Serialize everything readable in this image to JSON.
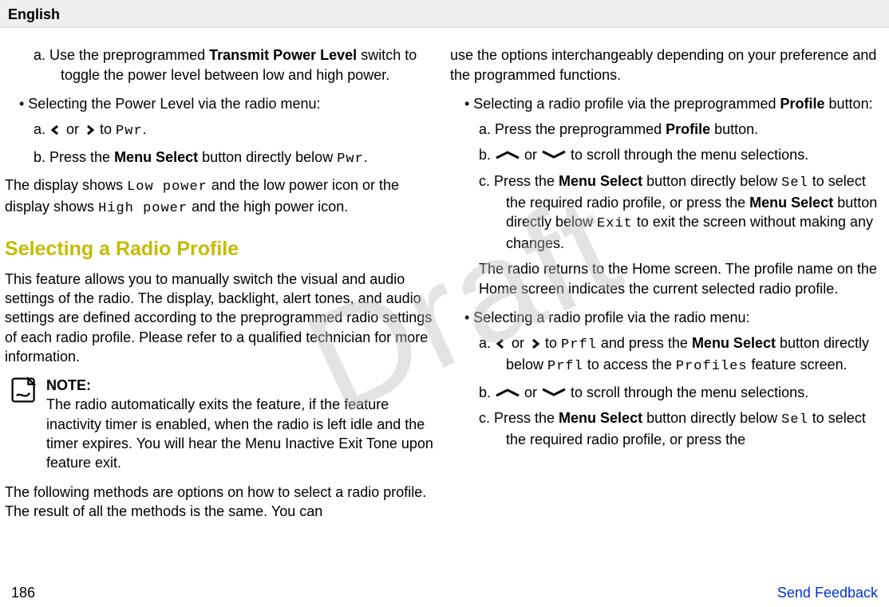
{
  "header": "English",
  "watermark": "Draft",
  "page_number": "186",
  "feedback_link": "Send Feedback",
  "section_heading": "Selecting a Radio Profile",
  "note_label": "NOTE:",
  "left": {
    "a1_pre": "a.   Use the preprogrammed ",
    "a1_bold": "Transmit Power Level",
    "a1_post": " switch to toggle the power level between low and high power.",
    "bullet1": "•   Selecting the Power Level via the radio menu:",
    "a2_pre": "a.   ",
    "a2_or": " or ",
    "a2_to": " to ",
    "a2_pwr": "Pwr",
    "a2_end": ".",
    "b1_pre": "b.   Press the ",
    "b1_bold": "Menu Select",
    "b1_post": " button directly below ",
    "b1_pwr": "Pwr",
    "b1_end": ".",
    "para1_pre": "The display shows ",
    "para1_low": "Low power",
    "para1_mid": " and the low power icon or the display shows ",
    "para1_high": "High power",
    "para1_end": " and the high power icon.",
    "intro": "This feature allows you to manually switch the visual and audio settings of the radio. The display, backlight, alert tones, and audio settings are defined according to the preprogrammed radio settings of each radio profile. Please refer to a qualified technician for more information.",
    "note_body": "The radio automatically exits the feature, if the feature inactivity timer is enabled, when the radio is left idle and the timer expires. You will hear the Menu Inactive Exit Tone upon feature exit.",
    "para2": "The following methods are options on how to select a radio profile. The result of all the methods is the same. You can"
  },
  "right": {
    "cont": "use the options interchangeably depending on your preference and the programmed functions.",
    "bullet1_pre": "•   Selecting a radio profile via the preprogrammed ",
    "bullet1_bold": "Profile",
    "bullet1_post": " button:",
    "r_a1_pre": "a.   Press the preprogrammed ",
    "r_a1_bold": "Profile",
    "r_a1_post": " button.",
    "r_b1_pre": "b.   ",
    "r_b1_or": " or ",
    "r_b1_post": " to scroll through the menu selections.",
    "r_c1_pre": "c.   Press the ",
    "r_c1_bold1": "Menu Select",
    "r_c1_mid1": " button directly below ",
    "r_c1_sel": "Sel",
    "r_c1_mid2": " to select the required radio profile, or press the ",
    "r_c1_bold2": "Menu Select",
    "r_c1_mid3": " button directly below ",
    "r_c1_exit": "Exit",
    "r_c1_end": " to exit the screen without making any changes.",
    "para3": "The radio returns to the Home screen. The profile name on the Home screen indicates the current selected radio profile.",
    "bullet2": "•   Selecting a radio profile via the radio menu:",
    "r_a2_pre": "a.   ",
    "r_a2_or": " or ",
    "r_a2_to": " to ",
    "r_a2_prfl": "Prfl",
    "r_a2_mid1": " and press the ",
    "r_a2_bold": "Menu Select",
    "r_a2_mid2": " button directly below ",
    "r_a2_prfl2": "Prfl",
    "r_a2_mid3": " to access the ",
    "r_a2_prof": "Profiles",
    "r_a2_end": " feature screen.",
    "r_b2_pre": "b.   ",
    "r_b2_or": " or ",
    "r_b2_post": " to scroll through the menu selections.",
    "r_c2_pre": "c.   Press the ",
    "r_c2_bold": "Menu Select",
    "r_c2_mid": " button directly below ",
    "r_c2_sel": "Sel",
    "r_c2_end": " to select the required radio profile, or press the"
  }
}
